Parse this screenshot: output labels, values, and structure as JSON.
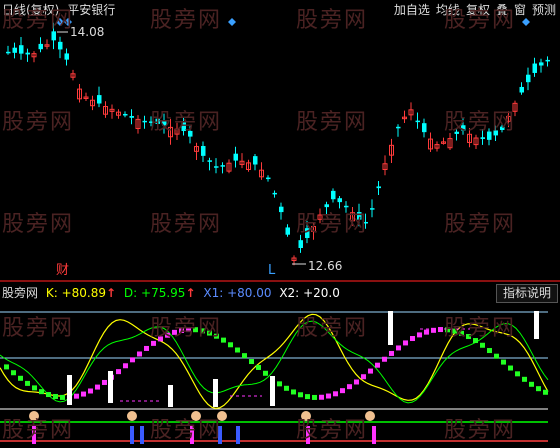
{
  "header": {
    "period": "日线(复权)",
    "stock_name": "平安银行",
    "menu": [
      "加自选",
      "均线",
      "复权",
      "叠",
      "窗",
      "预测"
    ]
  },
  "price_chart": {
    "high_label": "14.08",
    "low_label": "12.66",
    "marker_cai": "财",
    "marker_L": "L",
    "colors": {
      "up": "#ff3b3b",
      "down": "#00ffff",
      "diamond": "#3aa0ff"
    }
  },
  "indicator": {
    "name": "股旁网",
    "k_label": "K:",
    "k_value": "+80.89",
    "d_label": "D:",
    "d_value": "+75.95",
    "x1_label": "X1:",
    "x1_value": "+80.00",
    "x2_label": "X2:",
    "x2_value": "+20.0",
    "help_button": "指标说明",
    "colors": {
      "k": "#ffff00",
      "d": "#00ff00",
      "x1": "#5b8cff",
      "x2": "#ffffff"
    }
  },
  "watermark": "股旁网",
  "chart_data": {
    "type": "candlestick",
    "highest": 14.08,
    "lowest": 12.66
  }
}
